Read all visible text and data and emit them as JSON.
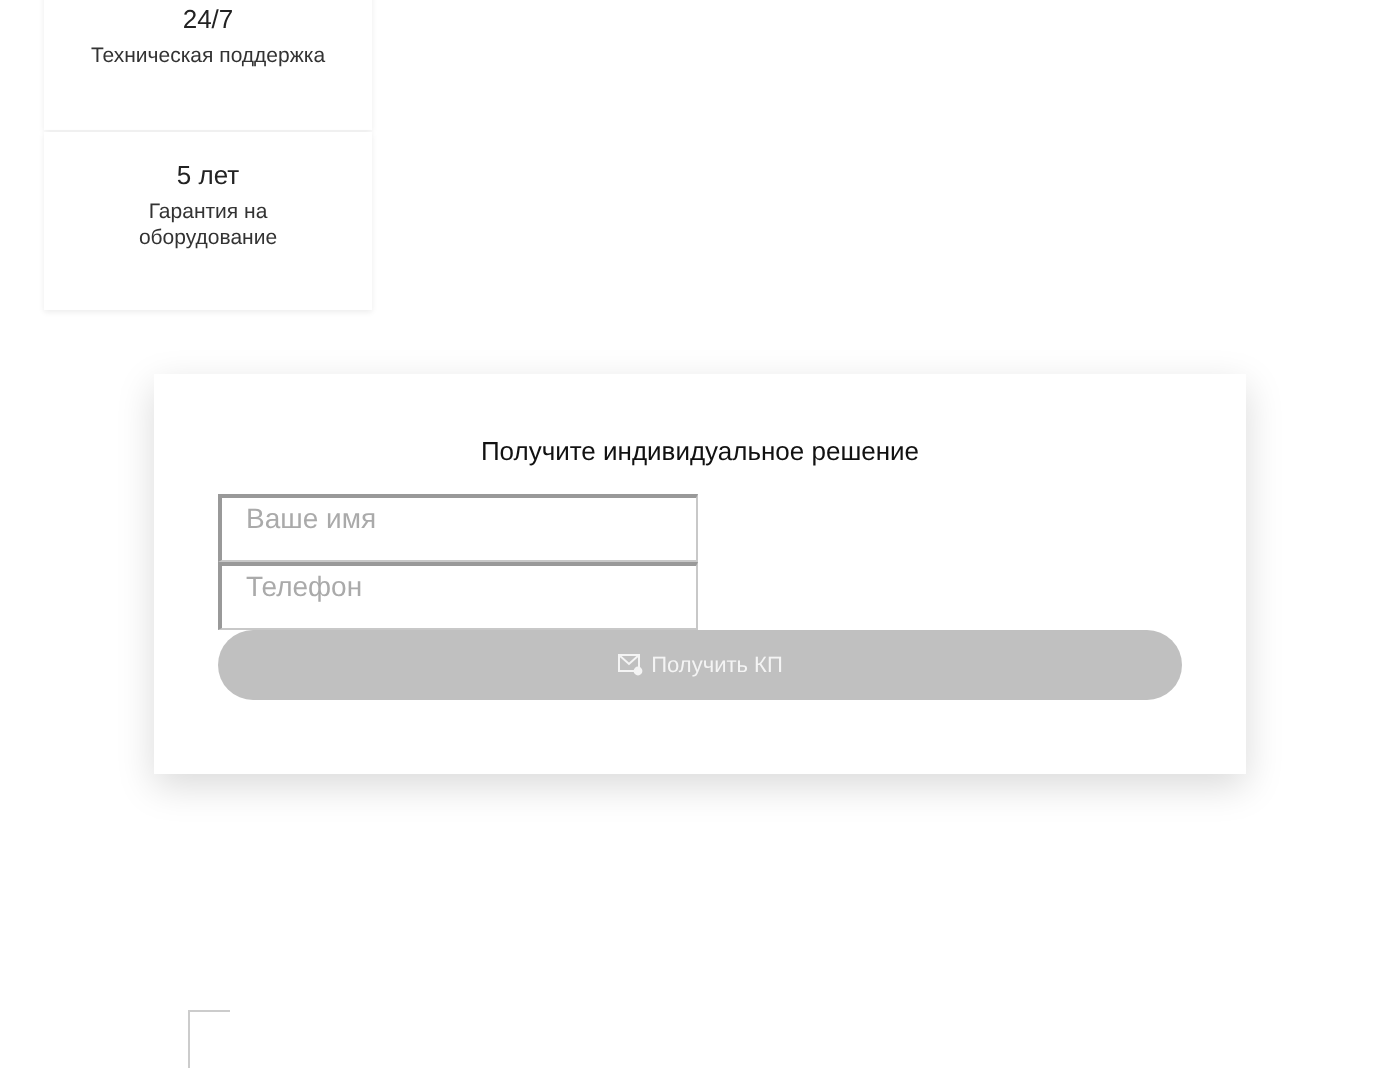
{
  "stats": [
    {
      "value": "24/7",
      "label": "Техническая поддержка"
    },
    {
      "value": "5 лет",
      "label": "Гарантия на оборудование"
    }
  ],
  "form": {
    "title": "Получите индивидуальное решение",
    "fields": [
      {
        "placeholder": "Ваше имя"
      },
      {
        "placeholder": "Телефон"
      }
    ],
    "button": {
      "label": "Получить КП",
      "disabled": true
    }
  }
}
